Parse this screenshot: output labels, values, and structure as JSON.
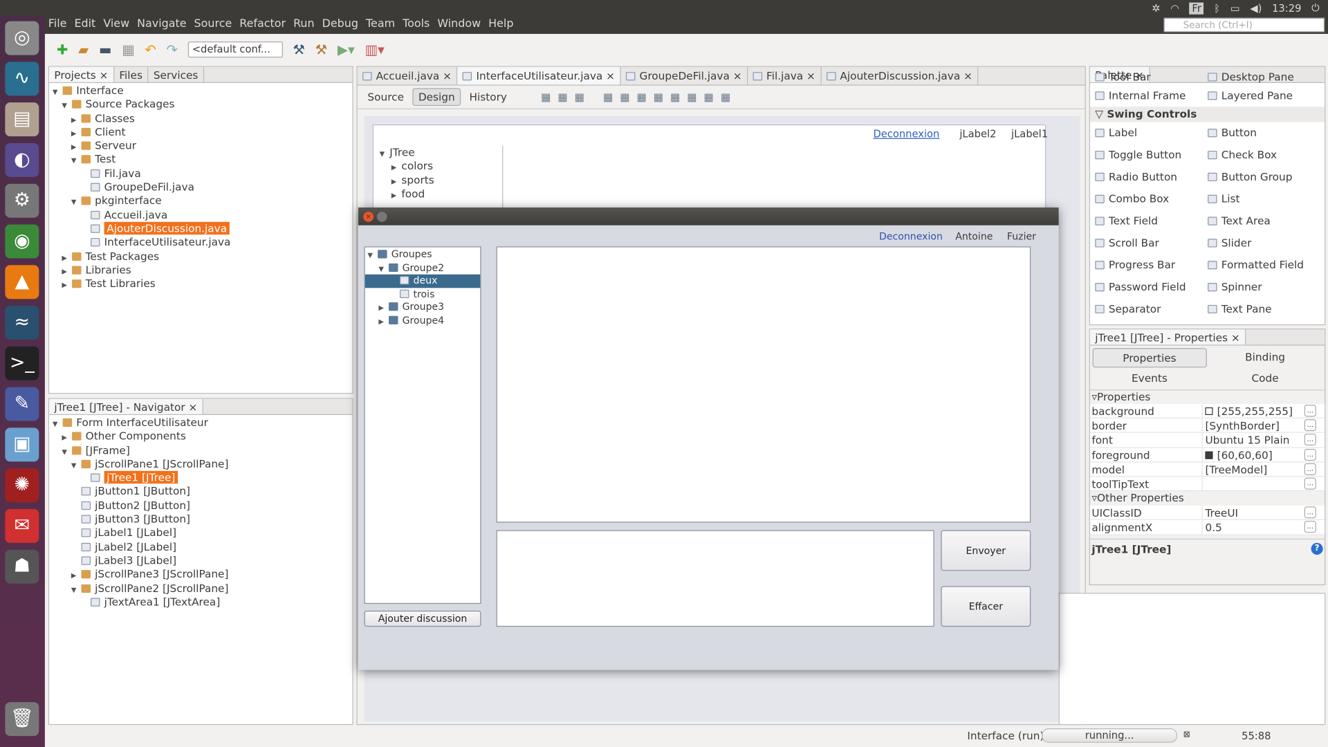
{
  "system": {
    "time": "13:29",
    "keyboard": "Fr",
    "search_placeholder": "Search (Ctrl+I)"
  },
  "menu": [
    "File",
    "Edit",
    "View",
    "Navigate",
    "Source",
    "Refactor",
    "Run",
    "Debug",
    "Team",
    "Tools",
    "Window",
    "Help"
  ],
  "toolbar": {
    "config": "<default conf..."
  },
  "projects": {
    "tabs": [
      "Projects",
      "Files",
      "Services"
    ],
    "tree": [
      {
        "label": "Interface",
        "level": 0,
        "exp": "open"
      },
      {
        "label": "Source Packages",
        "level": 1,
        "exp": "open"
      },
      {
        "label": "Classes",
        "level": 2,
        "exp": "closed"
      },
      {
        "label": "Client",
        "level": 2,
        "exp": "closed"
      },
      {
        "label": "Serveur",
        "level": 2,
        "exp": "closed"
      },
      {
        "label": "Test",
        "level": 2,
        "exp": "open"
      },
      {
        "label": "Fil.java",
        "level": 3
      },
      {
        "label": "GroupeDeFil.java",
        "level": 3
      },
      {
        "label": "pkginterface",
        "level": 2,
        "exp": "open"
      },
      {
        "label": "Accueil.java",
        "level": 3
      },
      {
        "label": "AjouterDiscussion.java",
        "level": 3,
        "selected": true
      },
      {
        "label": "InterfaceUtilisateur.java",
        "level": 3
      },
      {
        "label": "Test Packages",
        "level": 1,
        "exp": "closed"
      },
      {
        "label": "Libraries",
        "level": 1,
        "exp": "closed"
      },
      {
        "label": "Test Libraries",
        "level": 1,
        "exp": "closed"
      }
    ]
  },
  "navigator": {
    "title": "jTree1 [JTree] - Navigator",
    "tree": [
      {
        "label": "Form InterfaceUtilisateur",
        "level": 0,
        "exp": "open"
      },
      {
        "label": "Other Components",
        "level": 1,
        "exp": "closed"
      },
      {
        "label": "[JFrame]",
        "level": 1,
        "exp": "open"
      },
      {
        "label": "jScrollPane1 [JScrollPane]",
        "level": 2,
        "exp": "open"
      },
      {
        "label": "jTree1 [JTree]",
        "level": 3,
        "selected": true
      },
      {
        "label": "jButton1 [JButton]",
        "level": 2
      },
      {
        "label": "jButton2 [JButton]",
        "level": 2
      },
      {
        "label": "jButton3 [JButton]",
        "level": 2
      },
      {
        "label": "jLabel1 [JLabel]",
        "level": 2
      },
      {
        "label": "jLabel2 [JLabel]",
        "level": 2
      },
      {
        "label": "jLabel3 [JLabel]",
        "level": 2
      },
      {
        "label": "jScrollPane3 [JScrollPane]",
        "level": 2,
        "exp": "closed"
      },
      {
        "label": "jScrollPane2 [JScrollPane]",
        "level": 2,
        "exp": "open"
      },
      {
        "label": "jTextArea1 [JTextArea]",
        "level": 3
      }
    ]
  },
  "editor": {
    "tabs": [
      "Accueil.java",
      "InterfaceUtilisateur.java",
      "GroupeDeFil.java",
      "Fil.java",
      "AjouterDiscussion.java"
    ],
    "active_tab": 1,
    "modes": [
      "Source",
      "Design",
      "History"
    ],
    "design": {
      "labels": [
        "Deconnexion",
        "jLabel2",
        "jLabel1"
      ],
      "tree": [
        "JTree",
        "colors",
        "sports",
        "food"
      ]
    }
  },
  "palette": {
    "title": "Palette",
    "partial": [
      "Tool Bar",
      "Desktop Pane"
    ],
    "items": [
      "Internal Frame",
      "Layered Pane"
    ],
    "section": "Swing Controls",
    "controls": [
      "Label",
      "Button",
      "Toggle Button",
      "Check Box",
      "Radio Button",
      "Button Group",
      "Combo Box",
      "List",
      "Text Field",
      "Text Area",
      "Scroll Bar",
      "Slider",
      "Progress Bar",
      "Formatted Field",
      "Password Field",
      "Spinner",
      "Separator",
      "Text Pane"
    ]
  },
  "properties": {
    "title": "jTree1 [JTree] - Properties",
    "tabs": [
      "Properties",
      "Binding",
      "Events",
      "Code"
    ],
    "section1": "Properties",
    "rows1": [
      {
        "k": "background",
        "v": "[255,255,255]",
        "swatch": "#ffffff"
      },
      {
        "k": "border",
        "v": "[SynthBorder]"
      },
      {
        "k": "font",
        "v": "Ubuntu 15 Plain"
      },
      {
        "k": "foreground",
        "v": "[60,60,60]",
        "swatch": "#3c3c3c"
      },
      {
        "k": "model",
        "v": "[TreeModel]"
      },
      {
        "k": "toolTipText",
        "v": ""
      }
    ],
    "section2": "Other Properties",
    "rows2": [
      {
        "k": "UIClassID",
        "v": "TreeUI"
      },
      {
        "k": "alignmentX",
        "v": "0.5"
      }
    ],
    "footer": "jTree1 [JTree]"
  },
  "dialog": {
    "labels": {
      "logout": "Deconnexion",
      "first": "Antoine",
      "last": "Fuzier"
    },
    "tree": [
      {
        "label": "Groupes",
        "level": 0,
        "exp": "open",
        "type": "folder"
      },
      {
        "label": "Groupe2",
        "level": 1,
        "exp": "open",
        "type": "folder"
      },
      {
        "label": "deux",
        "level": 2,
        "type": "leaf",
        "selected": true
      },
      {
        "label": "trois",
        "level": 2,
        "type": "leaf"
      },
      {
        "label": "Groupe3",
        "level": 1,
        "exp": "closed",
        "type": "folder"
      },
      {
        "label": "Groupe4",
        "level": 1,
        "exp": "closed",
        "type": "folder"
      }
    ],
    "send": "Envoyer",
    "clear": "Effacer",
    "add": "Ajouter discussion"
  },
  "status": {
    "task": "Interface (run)",
    "progress": "running...",
    "position": "55:88"
  }
}
